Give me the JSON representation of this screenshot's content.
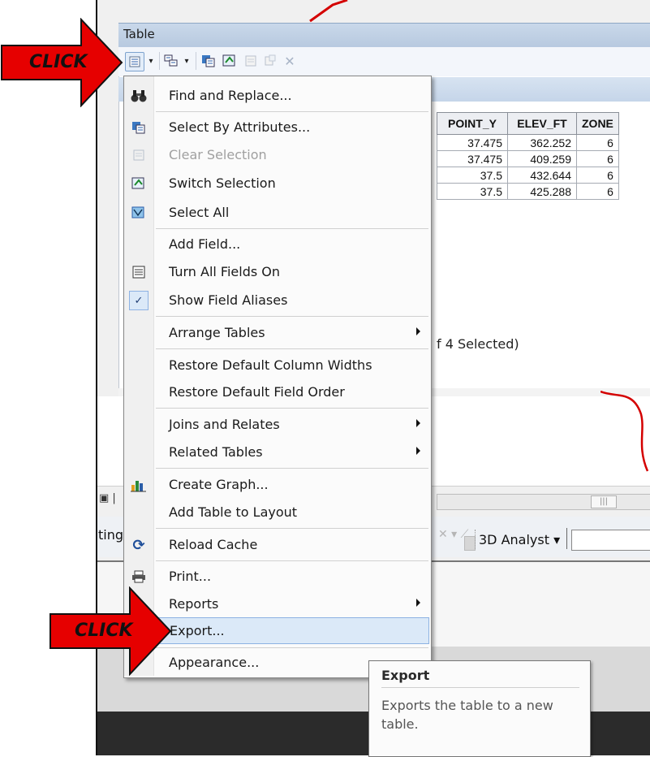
{
  "window": {
    "title": "Table"
  },
  "toolbar": {
    "buttons": [
      {
        "icon": "table-options-icon",
        "label": "▾"
      },
      {
        "icon": "related-tables-icon",
        "label": "▾"
      },
      {
        "icon": "select-by-attributes-icon"
      },
      {
        "icon": "switch-selection-icon"
      },
      {
        "icon": "clear-selection-icon",
        "enabled": false
      },
      {
        "icon": "delete-selected-icon",
        "enabled": false
      },
      {
        "icon": "delete-icon",
        "enabled": false
      }
    ]
  },
  "table": {
    "columns": [
      "POINT_Y",
      "ELEV_FT",
      "ZONE"
    ],
    "rows": [
      [
        "37.475",
        "362.252",
        "6"
      ],
      [
        "37.475",
        "409.259",
        "6"
      ],
      [
        "37.5",
        "432.644",
        "6"
      ],
      [
        "37.5",
        "425.288",
        "6"
      ]
    ],
    "selection_status": "f 4 Selected)"
  },
  "background_toolbar": {
    "partial_label": "ting",
    "analyst_label": "3D Analyst ▾"
  },
  "menu": {
    "items": [
      {
        "label": "Find and Replace...",
        "icon": "binoculars-icon",
        "enabled": true
      },
      {
        "label": "Select By Attributes...",
        "icon": "select-by-attributes-icon",
        "enabled": true
      },
      {
        "label": "Clear Selection",
        "icon": "clear-selection-icon",
        "enabled": false
      },
      {
        "label": "Switch Selection",
        "icon": "switch-selection-icon",
        "enabled": true
      },
      {
        "label": "Select All",
        "icon": "select-all-icon",
        "enabled": true
      },
      {
        "label": "Add Field...",
        "icon": "",
        "enabled": true
      },
      {
        "label": "Turn All Fields On",
        "icon": "fields-list-icon",
        "enabled": true
      },
      {
        "label": "Show Field Aliases",
        "icon": "checkmark-icon",
        "enabled": true,
        "checked": true
      },
      {
        "label": "Arrange Tables",
        "icon": "",
        "enabled": true,
        "submenu": true
      },
      {
        "label": "Restore Default Column Widths",
        "icon": "",
        "enabled": true
      },
      {
        "label": "Restore Default Field Order",
        "icon": "",
        "enabled": true
      },
      {
        "label": "Joins and Relates",
        "icon": "",
        "enabled": true,
        "submenu": true
      },
      {
        "label": "Related Tables",
        "icon": "",
        "enabled": true,
        "submenu": true
      },
      {
        "label": "Create Graph...",
        "icon": "bar-chart-icon",
        "enabled": true
      },
      {
        "label": "Add Table to Layout",
        "icon": "",
        "enabled": true
      },
      {
        "label": "Reload Cache",
        "icon": "refresh-icon",
        "enabled": true
      },
      {
        "label": "Print...",
        "icon": "printer-icon",
        "enabled": true
      },
      {
        "label": "Reports",
        "icon": "",
        "enabled": true,
        "submenu": true
      },
      {
        "label": "Export...",
        "icon": "",
        "enabled": true,
        "highlighted": true
      },
      {
        "label": "Appearance...",
        "icon": "",
        "enabled": true
      }
    ]
  },
  "tooltip": {
    "title": "Export",
    "body": "Exports the table to a new table."
  },
  "callouts": [
    {
      "text": "CLICK",
      "color": "#e60000"
    },
    {
      "text": "CLICK",
      "color": "#e60000"
    }
  ],
  "colors": {
    "highlight": "#dbe9f8",
    "title_bar": "#c9d8ea",
    "arrow_red": "#e60000"
  }
}
